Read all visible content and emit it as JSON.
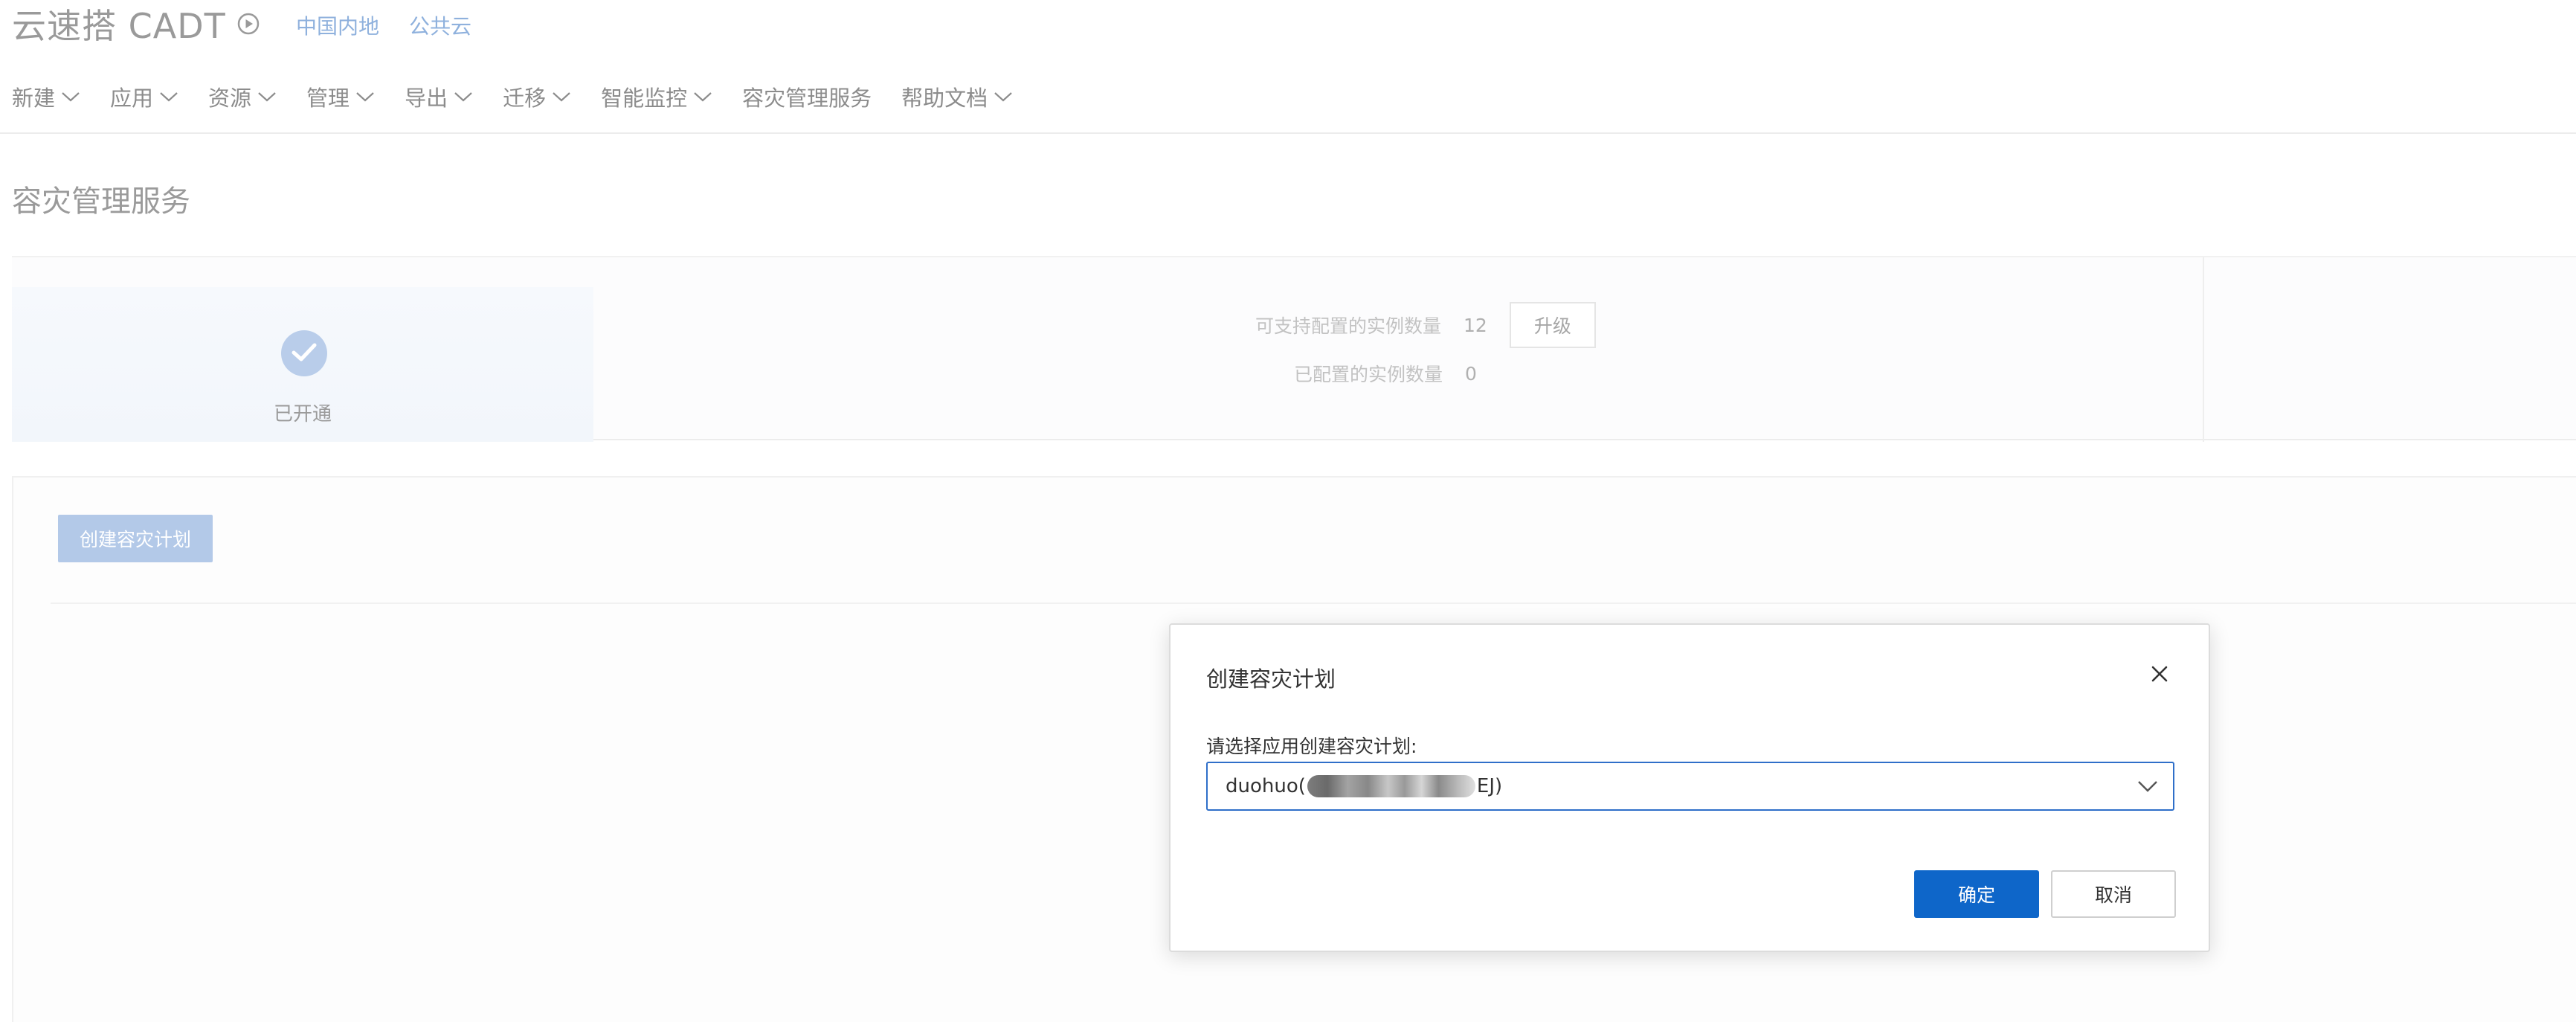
{
  "header": {
    "title": "云速搭 CADT",
    "play_icon": "play-circle-icon",
    "regions": [
      "中国内地",
      "公共云"
    ]
  },
  "menu": {
    "items": [
      {
        "label": "新建",
        "dropdown": true
      },
      {
        "label": "应用",
        "dropdown": true
      },
      {
        "label": "资源",
        "dropdown": true
      },
      {
        "label": "管理",
        "dropdown": true
      },
      {
        "label": "导出",
        "dropdown": true
      },
      {
        "label": "迁移",
        "dropdown": true
      },
      {
        "label": "智能监控",
        "dropdown": true
      },
      {
        "label": "容灾管理服务",
        "dropdown": false
      },
      {
        "label": "帮助文档",
        "dropdown": true
      }
    ]
  },
  "page": {
    "title": "容灾管理服务"
  },
  "status": {
    "label": "已开通",
    "icon": "check-circle-icon",
    "supported_label": "可支持配置的实例数量",
    "supported_value": "12",
    "upgrade_label": "升级",
    "configured_label": "已配置的实例数量",
    "configured_value": "0"
  },
  "plans": {
    "create_label": "创建容灾计划"
  },
  "dialog": {
    "title": "创建容灾计划",
    "field_label": "请选择应用创建容灾计划:",
    "select_prefix": "duohuo(",
    "select_suffix": "EJ)",
    "ok_label": "确定",
    "cancel_label": "取消"
  },
  "colors": {
    "primary": "#0e66c9",
    "link": "#8fb1dd",
    "disabled_primary": "#b3c9e8"
  }
}
